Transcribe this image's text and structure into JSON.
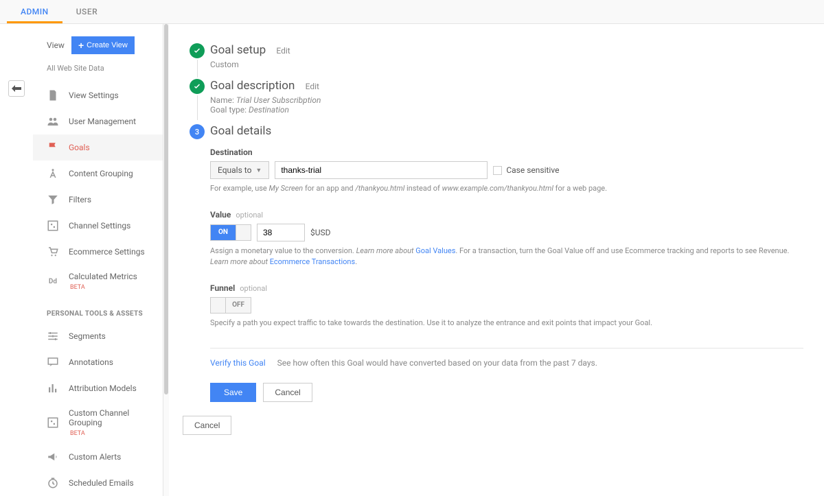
{
  "tabs": {
    "admin": "ADMIN",
    "user": "USER"
  },
  "sidebar": {
    "view_label": "View",
    "create_view": "Create View",
    "all_data": "All Web Site Data",
    "items": [
      {
        "label": "View Settings",
        "iconName": "file-icon"
      },
      {
        "label": "User Management",
        "iconName": "users-icon"
      },
      {
        "label": "Goals",
        "iconName": "flag-icon"
      },
      {
        "label": "Content Grouping",
        "iconName": "grouping-icon"
      },
      {
        "label": "Filters",
        "iconName": "funnel-icon"
      },
      {
        "label": "Channel Settings",
        "iconName": "channel-icon"
      },
      {
        "label": "Ecommerce Settings",
        "iconName": "cart-icon"
      },
      {
        "label": "Calculated Metrics",
        "iconName": "dd-icon",
        "beta": "BETA"
      }
    ],
    "personal_header": "PERSONAL TOOLS & ASSETS",
    "personal": [
      {
        "label": "Segments",
        "iconName": "segments-icon"
      },
      {
        "label": "Annotations",
        "iconName": "annotation-icon"
      },
      {
        "label": "Attribution Models",
        "iconName": "bars-icon"
      },
      {
        "label": "Custom Channel Grouping",
        "iconName": "channel-icon",
        "beta": "BETA"
      },
      {
        "label": "Custom Alerts",
        "iconName": "megaphone-icon"
      },
      {
        "label": "Scheduled Emails",
        "iconName": "clock-icon"
      }
    ]
  },
  "steps": {
    "step1": {
      "title": "Goal setup",
      "edit": "Edit",
      "sub": "Custom"
    },
    "step2": {
      "title": "Goal description",
      "edit": "Edit",
      "name_label": "Name:",
      "name_value": "Trial User Subscribption",
      "type_label": "Goal type:",
      "type_value": "Destination"
    },
    "step3": {
      "num": "3",
      "title": "Goal details"
    }
  },
  "dest": {
    "label": "Destination",
    "dropdown": "Equals to",
    "value": "thanks-trial",
    "case_sensitive": "Case sensitive",
    "help_pre": "For example, use ",
    "help_i1": "My Screen",
    "help_mid": " for an app and ",
    "help_i2": "/thankyou.html ",
    "help_mid2": "instead of ",
    "help_i3": "www.example.com/thankyou.html ",
    "help_post": "for a web page."
  },
  "value": {
    "label": "Value",
    "optional": "optional",
    "on": "ON",
    "amount": "38",
    "currency": "$USD",
    "help_pre": "Assign a monetary value to the conversion. ",
    "help_link1_pre": "Learn more about ",
    "help_link1": "Goal Values",
    "help_mid": ". For a transaction, turn the Goal Value off and use Ecommerce tracking and reports to see Revenue. ",
    "help_link2_pre": "Learn more about ",
    "help_link2": "Ecommerce Transactions",
    "help_post": "."
  },
  "funnel": {
    "label": "Funnel",
    "optional": "optional",
    "off": "OFF",
    "help": "Specify a path you expect traffic to take towards the destination. Use it to analyze the entrance and exit points that impact your Goal."
  },
  "verify": {
    "link": "Verify this Goal",
    "text": "See how often this Goal would have converted based on your data from the past 7 days."
  },
  "buttons": {
    "save": "Save",
    "cancel": "Cancel",
    "outer_cancel": "Cancel"
  }
}
